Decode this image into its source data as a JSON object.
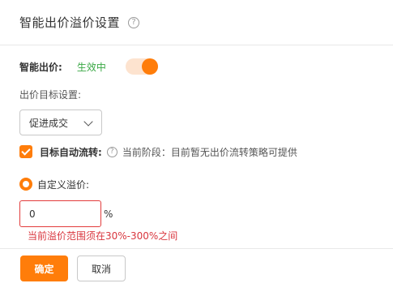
{
  "dialog": {
    "title": "智能出价溢价设置",
    "help_icon": "?"
  },
  "smart_bid": {
    "label": "智能出价:",
    "status": "生效中",
    "enabled": true
  },
  "target": {
    "label": "出价目标设置:",
    "select_value": "促进成交"
  },
  "auto_flow": {
    "checked": true,
    "label": "目标自动流转:",
    "help_icon": "?",
    "stage_text": "当前阶段：目前暂无出价流转策略可提供"
  },
  "custom_premium": {
    "selected": true,
    "label": "自定义溢价:",
    "value": "0",
    "unit": "%",
    "error": "当前溢价范围须在30%-300%之间"
  },
  "footer": {
    "confirm_label": "确定",
    "cancel_label": "取消"
  },
  "colors": {
    "accent": "#ff7d0a",
    "success": "#3aa845",
    "error": "#d9363e"
  }
}
